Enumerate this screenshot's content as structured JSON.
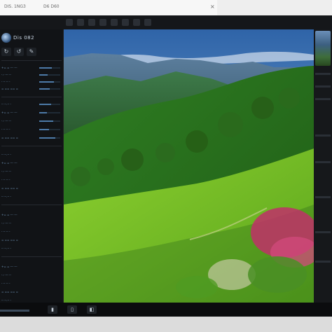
{
  "browser": {
    "tab_title": "DIS. 1NG3",
    "address_text": "D6 D60"
  },
  "app": {
    "brand": "Dis 082",
    "tools": [
      "↻",
      "↺",
      "✎"
    ],
    "panel_rows": [
      "+= = --- ---",
      "-.- --- --",
      "- -- -- -",
      "= == == =",
      "-- --.-- -"
    ],
    "accent": "#4d7aa8"
  },
  "bottom_bar": {
    "buttons": [
      "▮",
      "▯",
      "◧"
    ]
  },
  "photo": {
    "description_alt": ""
  }
}
